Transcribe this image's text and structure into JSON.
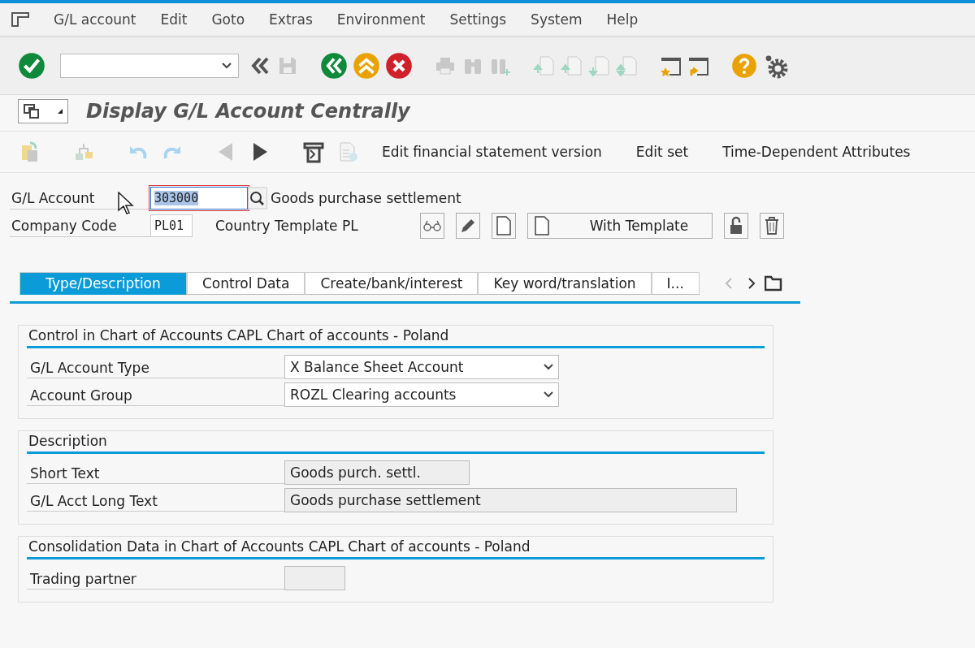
{
  "menu": [
    "G/L account",
    "Edit",
    "Goto",
    "Extras",
    "Environment",
    "Settings",
    "System",
    "Help"
  ],
  "title": "Display G/L Account Centrally",
  "app_toolbar": [
    "Edit financial statement version",
    "Edit set",
    "Time-Dependent Attributes"
  ],
  "header_fields": [
    {
      "label": "G/L Account",
      "value": "303000",
      "description": "Goods purchase settlement",
      "focused": true
    },
    {
      "label": "Company Code",
      "value": "PL01",
      "description": "Country Template PL",
      "focused": false
    }
  ],
  "template_button": "With Template",
  "tabs": [
    {
      "label": "Type/Description",
      "selected": true
    },
    {
      "label": "Control Data",
      "selected": false
    },
    {
      "label": "Create/bank/interest",
      "selected": false
    },
    {
      "label": "Key word/translation",
      "selected": false
    },
    {
      "label": "I...",
      "selected": false
    }
  ],
  "groups": [
    {
      "title": "Control in Chart of Accounts CAPL Chart of accounts - Poland",
      "rows": [
        {
          "label": "G/L Account Type",
          "kind": "dropdown",
          "value": "X Balance Sheet Account"
        },
        {
          "label": "Account Group",
          "kind": "dropdown",
          "value": "ROZL Clearing accounts"
        }
      ]
    },
    {
      "title": "Description",
      "rows": [
        {
          "label": "Short Text",
          "kind": "text",
          "value": "Goods purch. settl."
        },
        {
          "label": "G/L Acct Long Text",
          "kind": "text",
          "value": "Goods purchase settlement"
        }
      ]
    },
    {
      "title": "Consolidation Data in Chart of Accounts CAPL Chart of accounts - Poland",
      "rows": [
        {
          "label": "Trading partner",
          "kind": "text"
        }
      ]
    }
  ]
}
